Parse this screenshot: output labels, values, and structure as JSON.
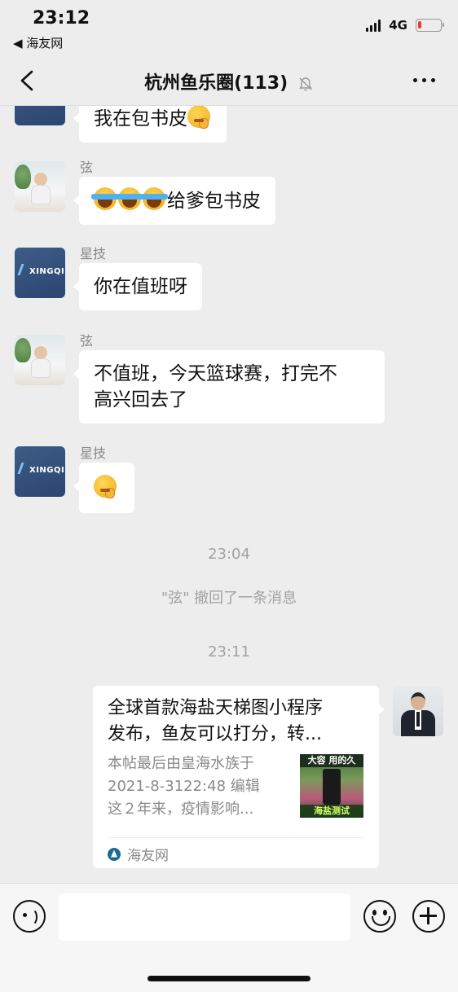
{
  "status_bar": {
    "time": "23:12",
    "back_app": "◀ 海友网",
    "network": "4G",
    "battery_level": 0.15
  },
  "nav": {
    "title": "杭州鱼乐圈(113)",
    "muted": true,
    "back_icon": "chevron-left-icon",
    "more_icon": "ellipsis-icon"
  },
  "messages": [
    {
      "sender": "",
      "text": "我在包书皮",
      "emoji_after": "thinking"
    },
    {
      "sender": "弦",
      "text": "给爹包书皮",
      "emoji_before": "crying-laughing x3"
    },
    {
      "sender": "星技",
      "text": "你在值班呀"
    },
    {
      "sender": "弦",
      "text_line1": "不值班，今天篮球赛，打完不",
      "text_line2": "高兴回去了"
    },
    {
      "sender": "星技",
      "text": "",
      "emoji": "thinking"
    }
  ],
  "system": {
    "timestamp1": "23:04",
    "recall_notice": "\"弦\" 撤回了一条消息",
    "timestamp2": "23:11"
  },
  "link_card": {
    "title_line1": "全球首款海盐天梯图小程序",
    "title_line2": "发布，鱼友可以打分，转...",
    "desc_line1": "本帖最后由皇海水族于",
    "desc_line2": "2021-8-3122:48 编辑",
    "desc_line3": "这２年来，疫情影响...",
    "thumb_top_text": "大容 用的久",
    "thumb_bottom_text": "海盐测试",
    "source": "海友网"
  },
  "input_bar": {
    "placeholder": "",
    "voice_icon": "voice-icon",
    "emoji_icon": "emoji-icon",
    "plus_icon": "plus-icon"
  },
  "colors": {
    "background": "#ededed",
    "bubble": "#ffffff",
    "battery_low": "#e53935"
  }
}
